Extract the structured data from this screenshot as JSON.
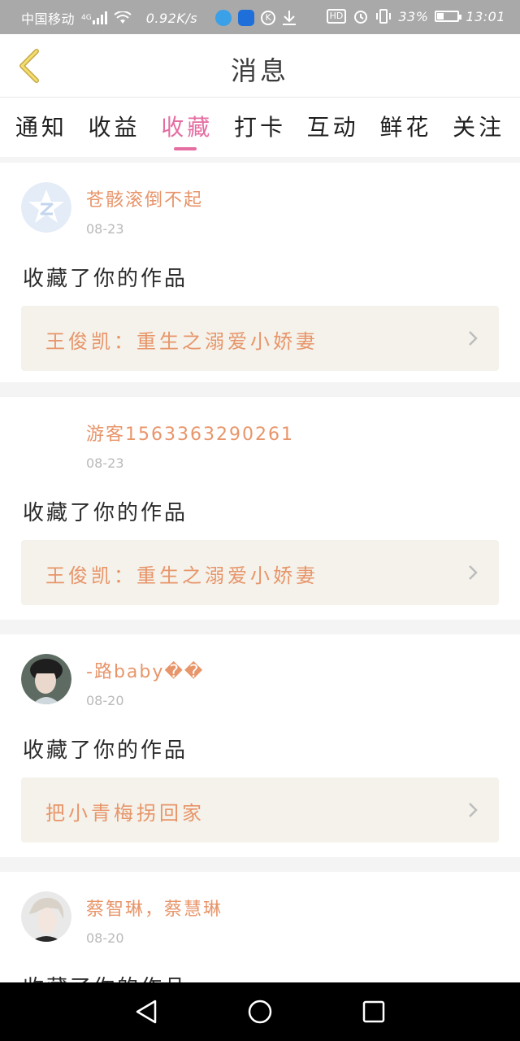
{
  "status_bar": {
    "carrier": "中国移动",
    "network": "4G",
    "speed": "0.92K/s",
    "hd": "HD",
    "battery_percent": "33%",
    "battery_level": 0.33,
    "time": "13:01"
  },
  "header": {
    "title": "消息",
    "back_icon": "chevron-left-icon"
  },
  "tabs": [
    {
      "label": "通知",
      "active": false
    },
    {
      "label": "收益",
      "active": false
    },
    {
      "label": "收藏",
      "active": true
    },
    {
      "label": "打卡",
      "active": false
    },
    {
      "label": "互动",
      "active": false
    },
    {
      "label": "鲜花",
      "active": false
    },
    {
      "label": "关注",
      "active": false
    }
  ],
  "messages": [
    {
      "username": "苍骸滚倒不起",
      "date": "08-23",
      "action": "收藏了你的作品",
      "work_title": "王俊凯：重生之溺爱小娇妻",
      "avatar": "default-star-avatar"
    },
    {
      "username": "游客1563363290261",
      "date": "08-23",
      "action": "收藏了你的作品",
      "work_title": "王俊凯：重生之溺爱小娇妻",
      "avatar": "empty-avatar"
    },
    {
      "username": "-路baby��",
      "date": "08-20",
      "action": "收藏了你的作品",
      "work_title": "把小青梅拐回家",
      "avatar": "photo-avatar"
    },
    {
      "username": "蔡智琳，蔡慧琳",
      "date": "08-20",
      "action": "收藏了你的作品",
      "avatar": "photo-avatar"
    }
  ],
  "colors": {
    "accent": "#e46da2",
    "username": "#e8956a",
    "work_box_bg": "#f4f2ea",
    "divider": "#f4f4f4"
  },
  "navbar": {
    "back": "triangle-back-icon",
    "home": "circle-home-icon",
    "recent": "square-recent-icon"
  }
}
